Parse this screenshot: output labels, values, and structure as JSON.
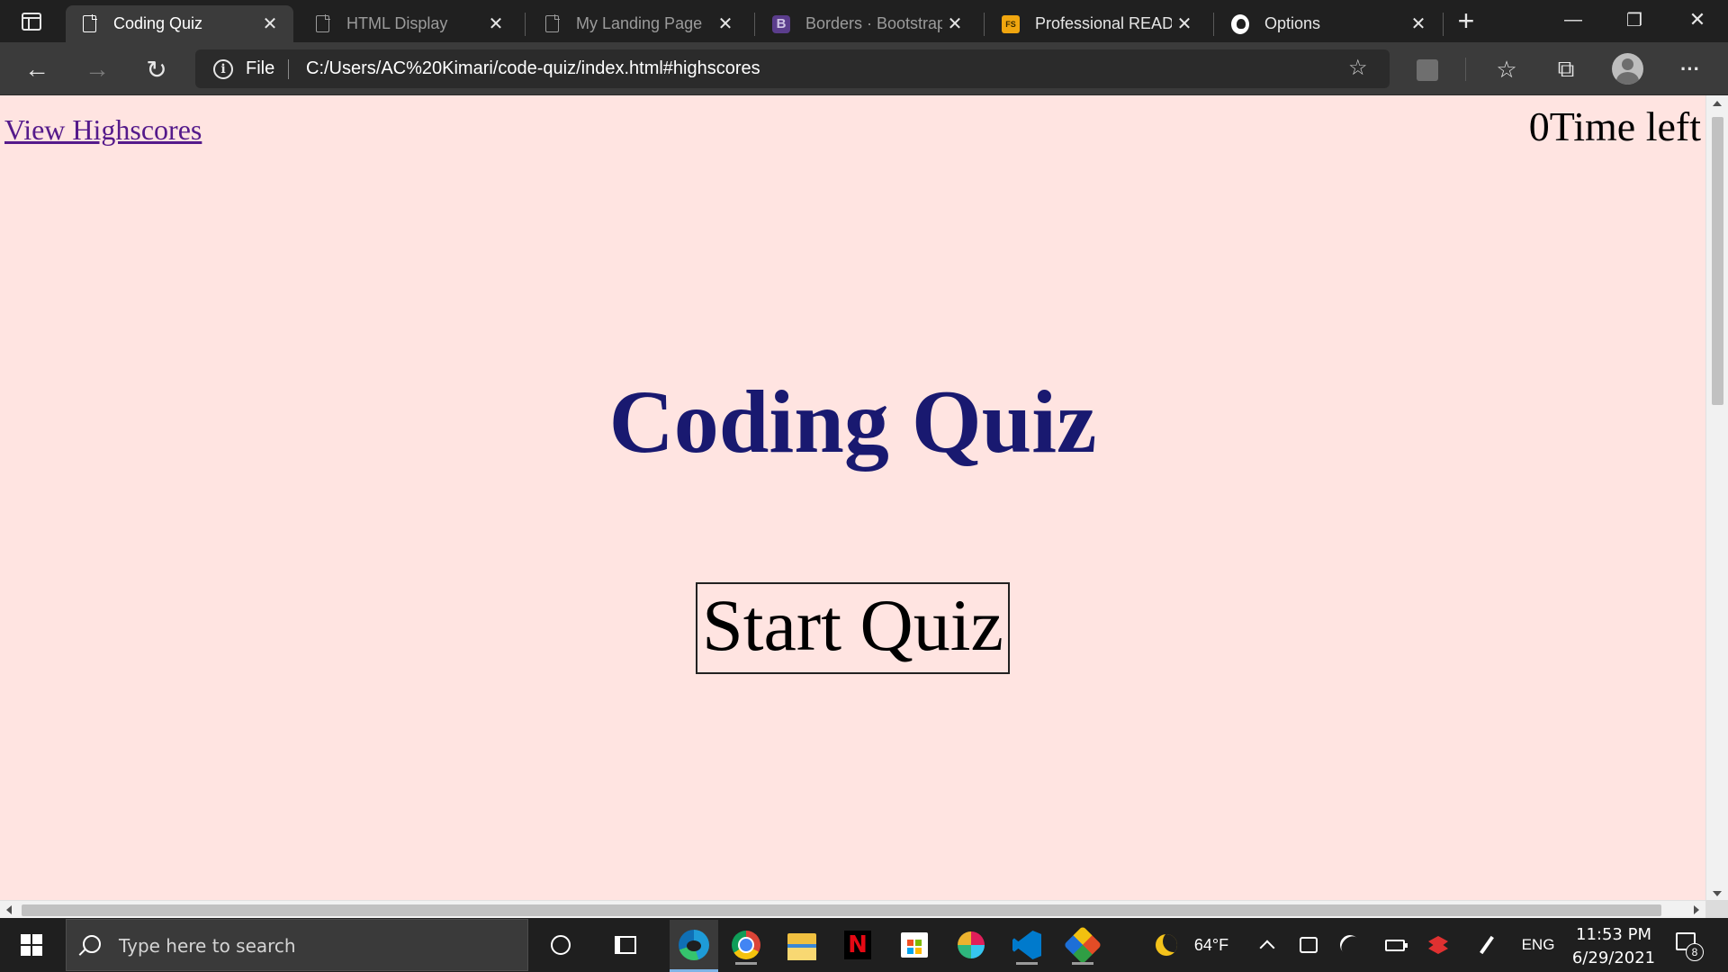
{
  "browser": {
    "tabs": [
      {
        "title": "Coding Quiz",
        "icon": "document-icon",
        "active": true
      },
      {
        "title": "HTML Display",
        "icon": "document-icon",
        "active": false
      },
      {
        "title": "My Landing Page",
        "icon": "document-icon",
        "active": false
      },
      {
        "title": "Borders · Bootstrap",
        "icon": "bootstrap-icon",
        "active": false
      },
      {
        "title": "Professional READM",
        "icon": "fs-icon",
        "active": false
      },
      {
        "title": "Options",
        "icon": "github-icon",
        "active": false
      }
    ],
    "close_glyph": "✕",
    "new_tab_glyph": "+",
    "window_controls": {
      "minimize": "—",
      "restore": "❐",
      "close": "✕"
    },
    "address": {
      "scheme_label": "File",
      "url": "C:/Users/AC%20Kimari/code-quiz/index.html#highscores"
    },
    "nav": {
      "back": "←",
      "forward": "→",
      "reload": "↻"
    },
    "toolbar_glyphs": {
      "favorite_add": "☆",
      "favorites": "☆",
      "collections": "⧉",
      "more": "···"
    }
  },
  "page": {
    "background": "#ffe4e1",
    "highscores_link": "View Highscores",
    "timer_value": "0",
    "timer_label": "Time left",
    "title": "Coding Quiz",
    "title_color": "#191970",
    "start_button": "Start Quiz"
  },
  "taskbar": {
    "search_placeholder": "Type here to search",
    "weather_temp": "64°F",
    "language": "ENG",
    "time": "11:53 PM",
    "date": "6/29/2021",
    "notification_count": "8"
  }
}
